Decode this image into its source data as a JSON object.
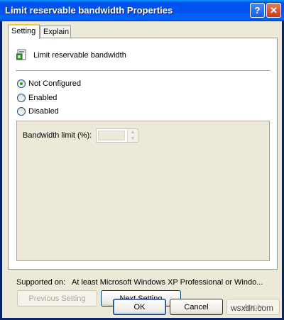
{
  "window": {
    "title": "Limit reservable bandwidth Properties"
  },
  "titlebar_buttons": {
    "help": "?",
    "close": "✕"
  },
  "tabs": [
    {
      "label": "Setting"
    },
    {
      "label": "Explain"
    }
  ],
  "policy": {
    "name": "Limit reservable bandwidth",
    "icon": "policy-icon"
  },
  "radios": [
    {
      "label": "Not Configured",
      "checked": true
    },
    {
      "label": "Enabled",
      "checked": false
    },
    {
      "label": "Disabled",
      "checked": false
    }
  ],
  "options": {
    "bandwidth_label": "Bandwidth limit (%):",
    "bandwidth_value": ""
  },
  "supported": {
    "label": "Supported on:",
    "value": "At least Microsoft Windows XP Professional or Windo..."
  },
  "nav": {
    "previous": "Previous Setting",
    "next": "Next Setting"
  },
  "dialog_buttons": {
    "ok": "OK",
    "cancel": "Cancel",
    "apply": "Apply"
  },
  "watermark": "wsxdn.com",
  "colors": {
    "title_bar": "#0053ee",
    "dialog_bg": "#ece9d8",
    "radio_dot": "#21a121",
    "tab_highlight": "#ffc83c"
  }
}
